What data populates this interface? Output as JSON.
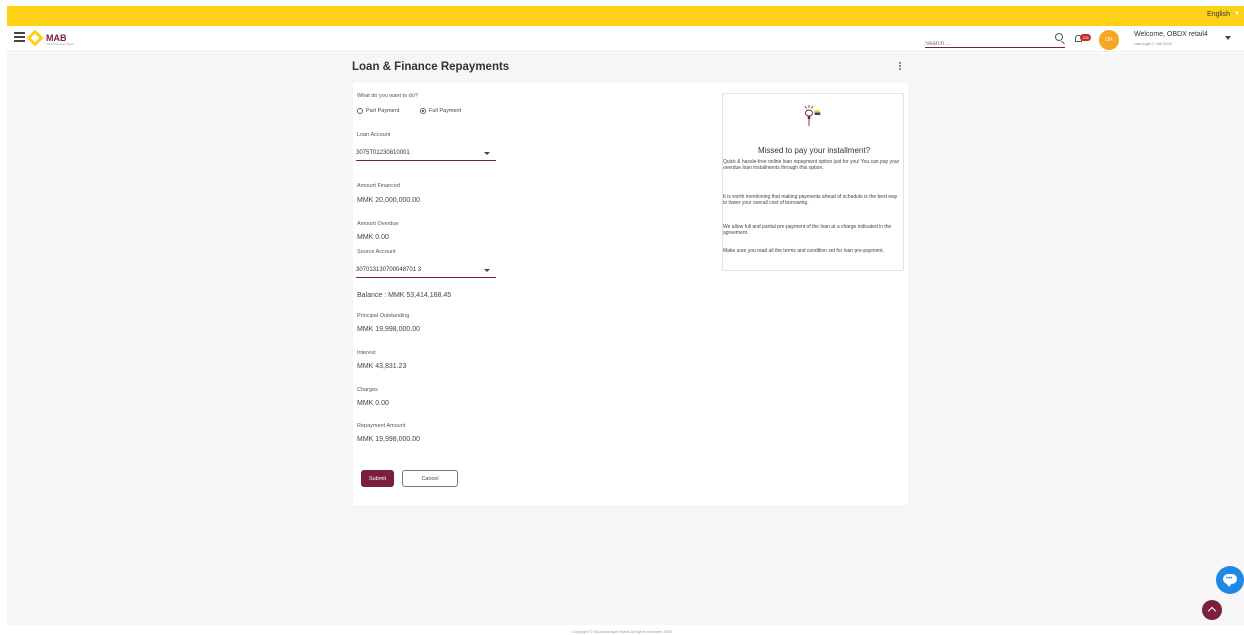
{
  "topbar": {
    "language": "English"
  },
  "header": {
    "brand": "MAB",
    "brand_tagline": "Myanma Apex Bank",
    "search_placeholder": "Search ...",
    "notification_count": "126",
    "avatar_initials": "OR",
    "welcome": "Welcome, OBDX retail4",
    "last_login": "Last login 2 Jan 2024"
  },
  "page": {
    "title": "Loan & Finance Repayments"
  },
  "form": {
    "question_label": "What do you want to do?",
    "options": [
      {
        "label": "Part Payment",
        "selected": false
      },
      {
        "label": "Full Payment",
        "selected": true
      }
    ],
    "loan_account_label": "Loan Account",
    "loan_account_value": "3075T01230810001",
    "amount_financed_label": "Amount Financed",
    "amount_financed_value": "MMK 20,000,000.00",
    "amount_overdue_label": "Amount Overdue",
    "amount_overdue_value": "MMK 0.00",
    "source_account_label": "Source Account",
    "source_account_value": "307013130700048701 3",
    "balance": "Balance : MMK 53,414,168.45",
    "principal_label": "Principal Outstanding",
    "principal_value": "MMK 19,998,000.00",
    "interest_label": "Interest",
    "interest_value": "MMK 43,831.23",
    "charges_label": "Charges",
    "charges_value": "MMK 0.00",
    "repayment_label": "Repayment Amount",
    "repayment_value": "MMK 19,998,000.00",
    "submit_label": "Submit",
    "cancel_label": "Cancel"
  },
  "info_card": {
    "title": "Missed to pay your installment?",
    "paragraphs": [
      "Quick & hassle-free online loan repayment option just for you! You can pay your overdue loan installments through this option.",
      "It is worth mentioning that making payments ahead of schedule is the best way to lower your overall cost of borrowing.",
      "We allow full and partial pre-payment of the loan at a charge indicated in the agreement.",
      "Make sure you read all the terms and condition set for loan pre-payment."
    ]
  },
  "footer": {
    "copyright": "Copyright © Myanma Apex Bank All rights reserved 2023"
  },
  "colors": {
    "brand_yellow": "#fcd116",
    "brand_maroon": "#7a1f3d",
    "chat_blue": "#1e88e5"
  },
  "icons": [
    "hamburger-icon",
    "search-icon",
    "bell-icon",
    "chevron-down-icon",
    "lightbulb-icon",
    "chat-icon",
    "chevron-up-icon",
    "kebab-icon"
  ]
}
